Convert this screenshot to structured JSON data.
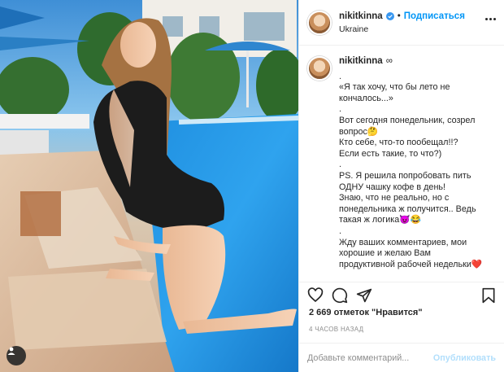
{
  "post": {
    "username": "nikitkinna",
    "follow_label": "Подписаться",
    "separator": "•",
    "location": "Ukraine",
    "infinity_mark": "∞",
    "caption_lines": [
      ".",
      "«Я так хочу, что бы лето не",
      "кончалось...»",
      ".",
      "Вот сегодня понедельник, созрел",
      "вопрос🤔",
      "Кто себе, что-то пообещал!!?",
      "Если есть такие, то что?)",
      ".",
      "PS. Я решила попробовать пить",
      "ОДНУ чашку кофе в день!",
      "Знаю, что не реально, но с",
      "понедельника ж получится.. Ведь",
      "такая ж логика😈😂",
      ".",
      "Жду ваших комментариев, мои",
      "хорошие и желаю Вам",
      "продуктивной рабочей недельки❤️"
    ],
    "likes_text": "2 669 отметок \"Нравится\"",
    "time_text": "4 часов назад",
    "comment_placeholder": "Добавьте комментарий...",
    "publish_label": "Опубликовать"
  },
  "icons": {
    "verified": "verified-badge-icon",
    "more": "more-options-icon",
    "like": "heart-icon",
    "comment": "comment-icon",
    "share": "share-icon",
    "save": "bookmark-icon",
    "tag": "user-tag-icon"
  },
  "colors": {
    "accent": "#0095f6",
    "publish_disabled": "#b2dffc",
    "muted": "#8e8e8e",
    "text": "#262626"
  }
}
